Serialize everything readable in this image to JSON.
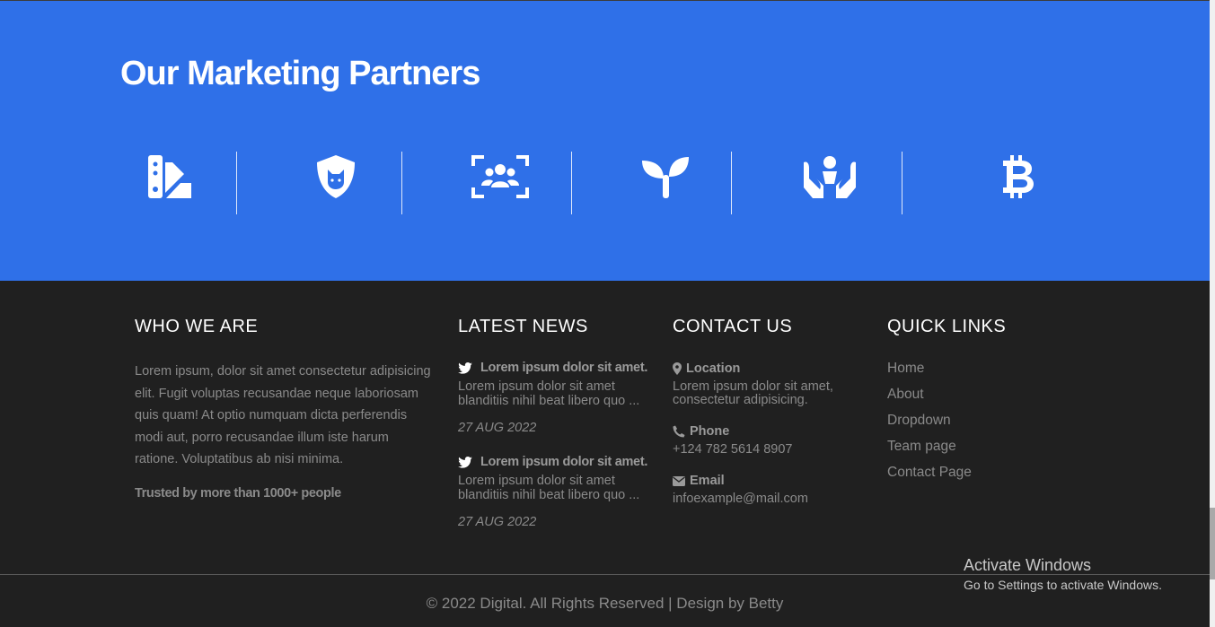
{
  "partners": {
    "title": "Our Marketing Partners",
    "background_color": "#2f70e8",
    "logos": [
      {
        "icon": "swatchbook-icon"
      },
      {
        "icon": "shield-cat-icon"
      },
      {
        "icon": "users-viewfinder-icon"
      },
      {
        "icon": "seedling-icon"
      },
      {
        "icon": "hands-holding-child-icon"
      },
      {
        "icon": "bitcoin-icon"
      }
    ]
  },
  "footer": {
    "background_color": "#202020",
    "who_we_are": {
      "heading": "WHO WE ARE",
      "text": "Lorem ipsum, dolor sit amet consectetur adipisicing elit. Fugit voluptas recusandae neque laboriosam quis quam! At optio numquam dicta perferendis modi aut, porro recusandae illum iste harum ratione. Voluptatibus ab nisi minima.",
      "trusted": "Trusted by more than 1000+ people"
    },
    "latest_news": {
      "heading": "LATEST NEWS",
      "items": [
        {
          "title": "Lorem ipsum dolor sit amet.",
          "body": "Lorem ipsum dolor sit amet blanditiis nihil beat libero quo ...",
          "date": "27 AUG 2022",
          "icon": "twitter-icon"
        },
        {
          "title": "Lorem ipsum dolor sit amet.",
          "body": "Lorem ipsum dolor sit amet blanditiis nihil beat libero quo ...",
          "date": "27 AUG 2022",
          "icon": "twitter-icon"
        }
      ]
    },
    "contact_us": {
      "heading": "CONTACT US",
      "location_label": "Location",
      "location_value": "Lorem ipsum dolor sit amet, consectetur adipisicing.",
      "phone_label": "Phone",
      "phone_value": "+124 782 5614 8907",
      "email_label": "Email",
      "email_value": "infoexample@mail.com"
    },
    "quick_links": {
      "heading": "QUICK LINKS",
      "links": [
        "Home",
        "About",
        "Dropdown",
        "Team page",
        "Contact Page"
      ]
    },
    "copyright": "© 2022 Digital. All Rights Reserved | Design by Betty"
  },
  "windows_watermark": {
    "line1": "Activate Windows",
    "line2": "Go to Settings to activate Windows."
  }
}
